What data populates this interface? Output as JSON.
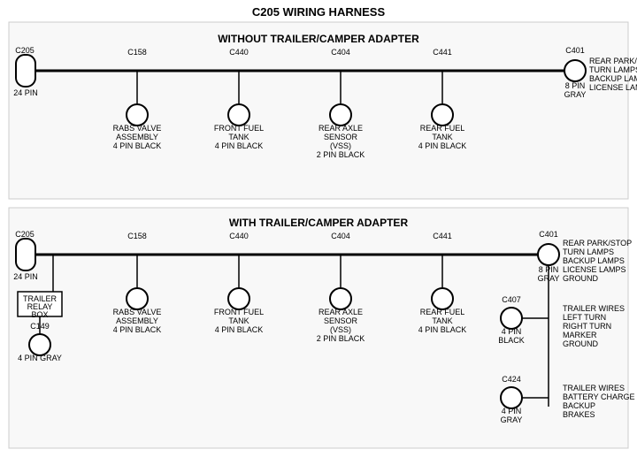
{
  "title": "C205 WIRING HARNESS",
  "section1": {
    "label": "WITHOUT  TRAILER/CAMPER  ADAPTER",
    "left_connector": {
      "id": "C205",
      "pin_label": "24 PIN"
    },
    "right_connector": {
      "id": "C401",
      "pin_label": "8 PIN",
      "color": "GRAY",
      "description": [
        "REAR PARK/STOP",
        "TURN LAMPS",
        "BACKUP LAMPS",
        "LICENSE LAMPS"
      ]
    },
    "connectors": [
      {
        "id": "C158",
        "lines": [
          "RABS VALVE",
          "ASSEMBLY",
          "4 PIN BLACK"
        ]
      },
      {
        "id": "C440",
        "lines": [
          "FRONT FUEL",
          "TANK",
          "4 PIN BLACK"
        ]
      },
      {
        "id": "C404",
        "lines": [
          "REAR AXLE",
          "SENSOR",
          "(VSS)",
          "2 PIN BLACK"
        ]
      },
      {
        "id": "C441",
        "lines": [
          "REAR FUEL",
          "TANK",
          "4 PIN BLACK"
        ]
      }
    ]
  },
  "section2": {
    "label": "WITH  TRAILER/CAMPER  ADAPTER",
    "left_connector": {
      "id": "C205",
      "pin_label": "24 PIN"
    },
    "right_connector": {
      "id": "C401",
      "pin_label": "8 PIN",
      "color": "GRAY",
      "description": [
        "REAR PARK/STOP",
        "TURN LAMPS",
        "BACKUP LAMPS",
        "LICENSE LAMPS",
        "GROUND"
      ]
    },
    "trailer_relay": {
      "label": "TRAILER",
      "label2": "RELAY",
      "label3": "BOX"
    },
    "c149": {
      "id": "C149",
      "pin_label": "4 PIN GRAY"
    },
    "connectors": [
      {
        "id": "C158",
        "lines": [
          "RABS VALVE",
          "ASSEMBLY",
          "4 PIN BLACK"
        ]
      },
      {
        "id": "C440",
        "lines": [
          "FRONT FUEL",
          "TANK",
          "4 PIN BLACK"
        ]
      },
      {
        "id": "C404",
        "lines": [
          "REAR AXLE",
          "SENSOR",
          "(VSS)",
          "2 PIN BLACK"
        ]
      },
      {
        "id": "C441",
        "lines": [
          "REAR FUEL",
          "TANK",
          "4 PIN BLACK"
        ]
      }
    ],
    "c407": {
      "id": "C407",
      "pin_label": "4 PIN",
      "color": "BLACK",
      "description": [
        "TRAILER WIRES",
        "LEFT TURN",
        "RIGHT TURN",
        "MARKER",
        "GROUND"
      ]
    },
    "c424": {
      "id": "C424",
      "pin_label": "4 PIN",
      "color": "GRAY",
      "description": [
        "TRAILER WIRES",
        "BATTERY CHARGE",
        "BACKUP",
        "BRAKES"
      ]
    }
  }
}
